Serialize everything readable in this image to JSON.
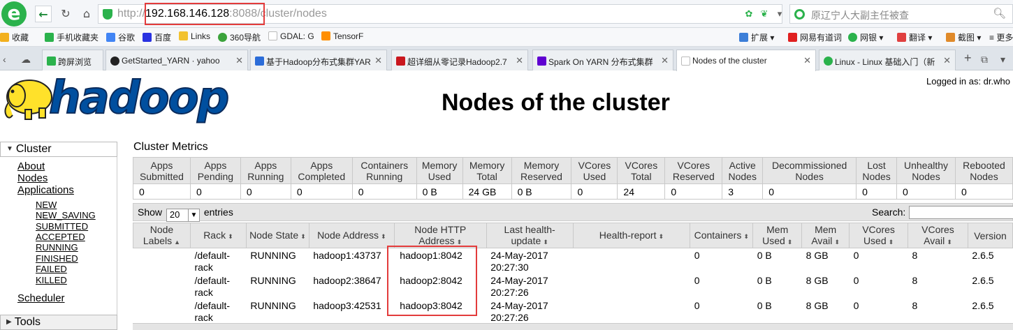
{
  "browser": {
    "url_protocol": "http://",
    "url_host": "192.168.146.128",
    "url_port": ":8088",
    "url_path": "/cluster/nodes",
    "search_placeholder": "原辽宁人大副主任被查",
    "bookmarks": [
      {
        "label": "收藏",
        "icon": "star-icon",
        "color": "#f2b01e"
      },
      {
        "label": "手机收藏夹",
        "icon": "phone-icon",
        "color": "#2bb24c"
      },
      {
        "label": "谷歌",
        "icon": "google-icon",
        "color": "#4285f4"
      },
      {
        "label": "百度",
        "icon": "baidu-icon",
        "color": "#2932e1"
      },
      {
        "label": "Links",
        "icon": "folder-icon",
        "color": "#f2c230"
      },
      {
        "label": "360导航",
        "icon": "360-icon",
        "color": "#3ca33c"
      },
      {
        "label": "GDAL: G",
        "icon": "page-icon",
        "color": "#bbbbbb"
      },
      {
        "label": "TensorF",
        "icon": "tensorflow-icon",
        "color": "#ff8f00"
      },
      {
        "label": "扩展",
        "icon": "extensions-icon",
        "color": "#3d7fd8"
      },
      {
        "label": "网易有道词",
        "icon": "youdao-icon",
        "color": "#e02020"
      },
      {
        "label": "网银",
        "icon": "bank-icon",
        "color": "#2bb24c"
      },
      {
        "label": "翻译",
        "icon": "translate-icon",
        "color": "#e04040"
      },
      {
        "label": "截图",
        "icon": "screenshot-icon",
        "color": "#e08a2a"
      },
      {
        "label": "更多",
        "icon": "more-icon",
        "color": "#888888"
      }
    ],
    "tabs": [
      {
        "label": "跨屏浏览",
        "icon": "phone-icon",
        "color": "#2bb24c",
        "active": false
      },
      {
        "label": "GetStarted_YARN · yahoo",
        "icon": "github-icon",
        "color": "#222222",
        "active": false
      },
      {
        "label": "基于Hadoop分布式集群YAR",
        "icon": "hadoop-page-icon",
        "color": "#2b6cd8",
        "active": false
      },
      {
        "label": "超详细从零记录Hadoop2.7",
        "icon": "csdn-icon",
        "color": "#c9171e",
        "active": false
      },
      {
        "label": "Spark On YARN 分布式集群",
        "icon": "yahoo-icon",
        "color": "#5f01d1",
        "active": false
      },
      {
        "label": "Nodes of the cluster",
        "icon": "page-icon",
        "color": "#bbbbbb",
        "active": true
      },
      {
        "label": "Linux - Linux 基础入门（新",
        "icon": "leaf-icon",
        "color": "#2bb24c",
        "active": false
      }
    ]
  },
  "page": {
    "title": "Nodes of the cluster",
    "logged_in": "Logged in as: dr.who",
    "logo_text": "hadoop"
  },
  "nav": {
    "cluster_label": "Cluster",
    "links": [
      "About",
      "Nodes",
      "Applications"
    ],
    "app_states": [
      "NEW",
      "NEW_SAVING",
      "SUBMITTED",
      "ACCEPTED",
      "RUNNING",
      "FINISHED",
      "FAILED",
      "KILLED"
    ],
    "scheduler": "Scheduler",
    "tools_label": "Tools"
  },
  "metrics": {
    "title": "Cluster Metrics",
    "headers": [
      "Apps Submitted",
      "Apps Pending",
      "Apps Running",
      "Apps Completed",
      "Containers Running",
      "Memory Used",
      "Memory Total",
      "Memory Reserved",
      "VCores Used",
      "VCores Total",
      "VCores Reserved",
      "Active Nodes",
      "Decommissioned Nodes",
      "Lost Nodes",
      "Unhealthy Nodes",
      "Rebooted Nodes"
    ],
    "values": [
      "0",
      "0",
      "0",
      "0",
      "0",
      "0 B",
      "24 GB",
      "0 B",
      "0",
      "24",
      "0",
      "3",
      "0",
      "0",
      "0",
      "0"
    ]
  },
  "table_controls": {
    "show_label": "Show",
    "entries_value": "20",
    "entries_label": "entries",
    "search_label": "Search:"
  },
  "nodes": {
    "headers": [
      "Node Labels",
      "Rack",
      "Node State",
      "Node Address",
      "Node HTTP Address",
      "Last health-update",
      "Health-report",
      "Containers",
      "Mem Used",
      "Mem Avail",
      "VCores Used",
      "VCores Avail",
      "Version"
    ],
    "rows": [
      {
        "labels": "",
        "rack": "/default-rack",
        "state": "RUNNING",
        "address": "hadoop1:43737",
        "http": "hadoop1:8042",
        "health_update": "24-May-2017 20:27:30",
        "report": "",
        "containers": "0",
        "mem_used": "0 B",
        "mem_avail": "8 GB",
        "vcores_used": "0",
        "vcores_avail": "8",
        "version": "2.6.5"
      },
      {
        "labels": "",
        "rack": "/default-rack",
        "state": "RUNNING",
        "address": "hadoop2:38647",
        "http": "hadoop2:8042",
        "health_update": "24-May-2017 20:27:26",
        "report": "",
        "containers": "0",
        "mem_used": "0 B",
        "mem_avail": "8 GB",
        "vcores_used": "0",
        "vcores_avail": "8",
        "version": "2.6.5"
      },
      {
        "labels": "",
        "rack": "/default-rack",
        "state": "RUNNING",
        "address": "hadoop3:42531",
        "http": "hadoop3:8042",
        "health_update": "24-May-2017 20:27:26",
        "report": "",
        "containers": "0",
        "mem_used": "0 B",
        "mem_avail": "8 GB",
        "vcores_used": "0",
        "vcores_avail": "8",
        "version": "2.6.5"
      }
    ]
  },
  "colors": {
    "highlight": "#e33b3b",
    "browser_green": "#2bb24c",
    "hadoop_blue": "#004f9f",
    "elephant_yellow": "#ffe12a"
  }
}
